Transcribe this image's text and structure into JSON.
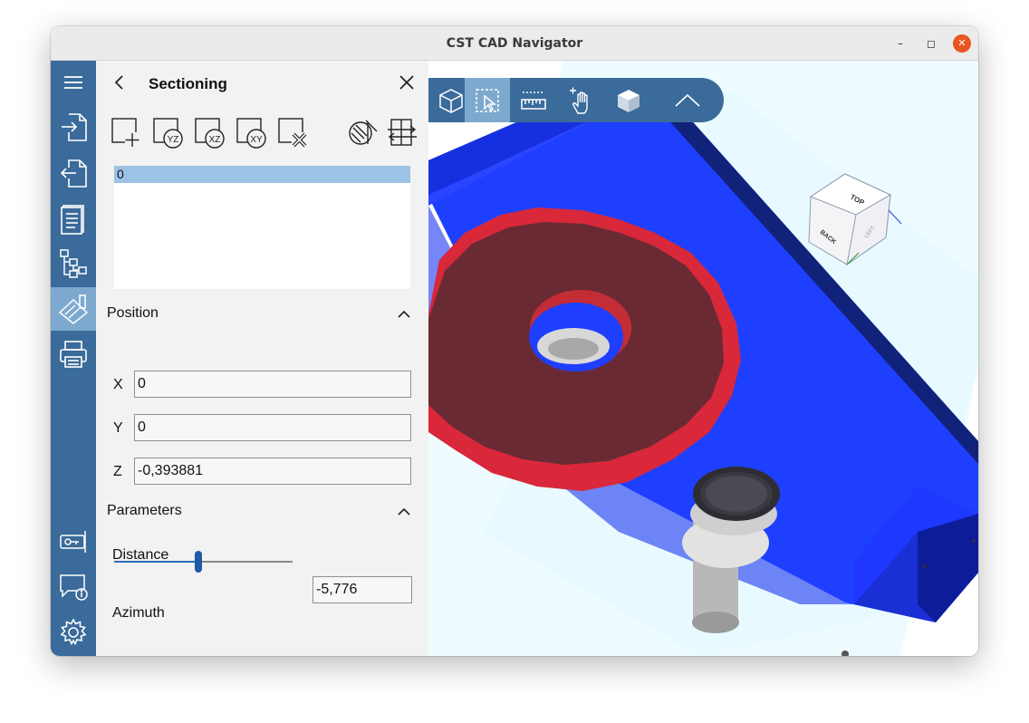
{
  "window": {
    "title": "CST CAD Navigator"
  },
  "panel": {
    "title": "Sectioning",
    "list": {
      "items": [
        "0"
      ]
    },
    "position": {
      "heading": "Position",
      "x_label": "X",
      "x_value": "0",
      "y_label": "Y",
      "y_value": "0",
      "z_label": "Z",
      "z_value": "-0,393881"
    },
    "parameters": {
      "heading": "Parameters",
      "distance_label": "Distance",
      "distance_value": "-5,776",
      "distance_slider_fraction": 0.47,
      "azimuth_label": "Azimuth"
    }
  },
  "view_cube": {
    "top_label": "TOP",
    "back_label": "BACK",
    "side_label": "LEFT"
  },
  "colors": {
    "sidebar": "#3a6b9a",
    "active": "#7ea9cf",
    "base_plate": "#1f3fff",
    "gear_face": "#6a2a33",
    "gear_teeth": "#d8283a",
    "list_selection": "#9cc3e5",
    "close_button": "#e95420"
  },
  "icons": {
    "sidebar": [
      "menu-icon",
      "import-icon",
      "export-icon",
      "document-icon",
      "tree-icon",
      "sectioning-icon",
      "print-icon",
      "license-icon",
      "feedback-icon",
      "settings-icon"
    ],
    "tools": [
      "add-section-icon",
      "yz-plane-icon",
      "xz-plane-icon",
      "xy-plane-icon",
      "delete-section-icon",
      "clip-toggle-icon",
      "flip-section-icon"
    ],
    "toolbar": [
      "cube-view-icon",
      "select-icon",
      "measure-icon",
      "pan-icon",
      "shaded-cube-icon",
      "collapse-icon"
    ]
  }
}
